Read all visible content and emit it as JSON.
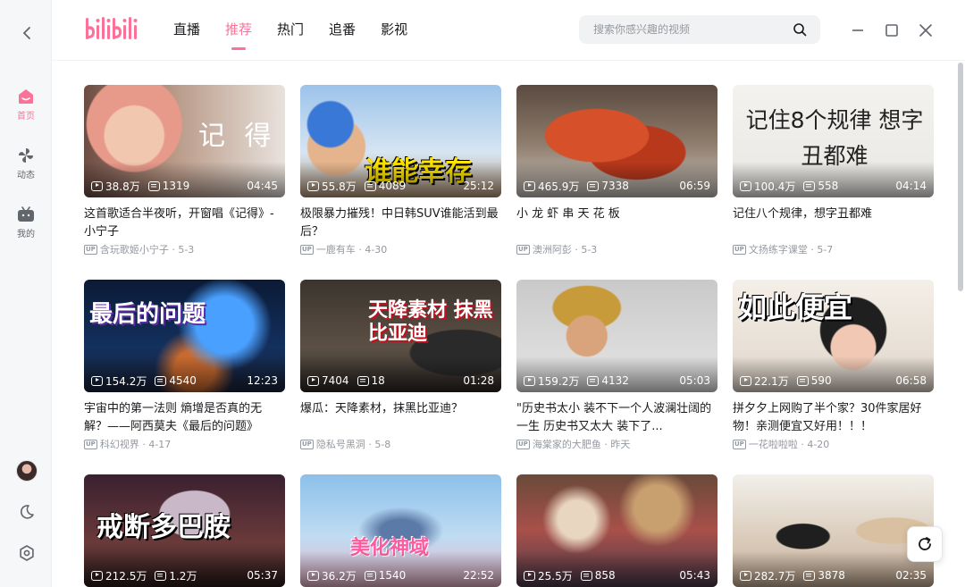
{
  "header": {
    "tabs": [
      {
        "label": "直播",
        "active": false
      },
      {
        "label": "推荐",
        "active": true
      },
      {
        "label": "热门",
        "active": false
      },
      {
        "label": "追番",
        "active": false
      },
      {
        "label": "影视",
        "active": false
      }
    ],
    "search_placeholder": "搜索你感兴趣的视频"
  },
  "sidebar": {
    "items": [
      {
        "label": "首页",
        "icon": "home-icon",
        "active": true
      },
      {
        "label": "动态",
        "icon": "pinwheel-icon",
        "active": false
      },
      {
        "label": "我的",
        "icon": "tv-icon",
        "active": false
      }
    ]
  },
  "accent_color": "#fb7299",
  "videos": [
    {
      "title": "这首歌适合半夜听，开窗唱《记得》- 小宁子",
      "views": "38.8万",
      "danmaku": "1319",
      "duration": "04:45",
      "uploader": "含玩歌姬小宁子",
      "date": "5-3",
      "thumb_text": "记 得"
    },
    {
      "title": "极限暴力摧残！中日韩SUV谁能活到最后？",
      "views": "55.8万",
      "danmaku": "4089",
      "duration": "25:12",
      "uploader": "一鹿有车",
      "date": "4-30",
      "thumb_text": "谁能幸存"
    },
    {
      "title": "小 龙 虾 串 天 花 板",
      "views": "465.9万",
      "danmaku": "7338",
      "duration": "06:59",
      "uploader": "澳洲阿彭",
      "date": "5-3",
      "thumb_text": ""
    },
    {
      "title": "记住八个规律，想字丑都难",
      "views": "100.4万",
      "danmaku": "558",
      "duration": "04:14",
      "uploader": "文扬练字课堂",
      "date": "5-7",
      "thumb_text": "记住8个规律 想字丑都难"
    },
    {
      "title": "宇宙中的第一法则 熵增是否真的无解？——阿西莫夫《最后的问题》",
      "views": "154.2万",
      "danmaku": "4540",
      "duration": "12:23",
      "uploader": "科幻视界",
      "date": "4-17",
      "thumb_text": "最后的问题"
    },
    {
      "title": "爆瓜：天降素材，抹黑比亚迪？",
      "views": "7404",
      "danmaku": "18",
      "duration": "01:28",
      "uploader": "隐私号黑洞",
      "date": "5-8",
      "thumb_text": "天降素材 抹黑 比亚迪"
    },
    {
      "title": "\"历史书太小 装不下一个人波澜壮阔的一生 历史书又太大 装下了...",
      "views": "159.2万",
      "danmaku": "4132",
      "duration": "05:03",
      "uploader": "海棠家的大肥鱼",
      "date": "昨天",
      "thumb_text": ""
    },
    {
      "title": "拼夕夕上网购了半个家？30件家居好物！亲测便宜又好用！！！",
      "views": "22.1万",
      "danmaku": "590",
      "duration": "06:58",
      "uploader": "一花啦啦啦",
      "date": "4-20",
      "thumb_text": "如此便宜"
    },
    {
      "title": "",
      "views": "212.5万",
      "danmaku": "1.2万",
      "duration": "05:37",
      "uploader": "",
      "date": "",
      "thumb_text": "戒断多巴胺"
    },
    {
      "title": "",
      "views": "36.2万",
      "danmaku": "1540",
      "duration": "22:52",
      "uploader": "",
      "date": "",
      "thumb_text": "美化神域"
    },
    {
      "title": "",
      "views": "25.5万",
      "danmaku": "858",
      "duration": "05:43",
      "uploader": "",
      "date": "",
      "thumb_text": ""
    },
    {
      "title": "",
      "views": "282.7万",
      "danmaku": "3878",
      "duration": "02:35",
      "uploader": "",
      "date": "",
      "thumb_text": ""
    }
  ]
}
